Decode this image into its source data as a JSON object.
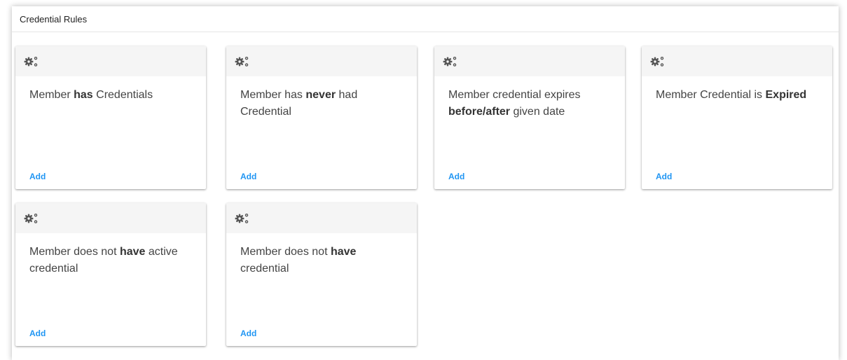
{
  "panel": {
    "title": "Credential Rules"
  },
  "cards": [
    {
      "icon": "gears-icon",
      "text_parts": [
        "Member ",
        "has",
        " Credentials"
      ],
      "action_label": "Add"
    },
    {
      "icon": "gears-icon",
      "text_parts": [
        "Member has ",
        "never",
        " had Credential"
      ],
      "action_label": "Add"
    },
    {
      "icon": "gears-icon",
      "text_parts": [
        "Member credential expires ",
        "before/after",
        " given date"
      ],
      "action_label": "Add"
    },
    {
      "icon": "gears-icon",
      "text_parts": [
        "Member Credential is ",
        "Expired",
        ""
      ],
      "action_label": "Add"
    },
    {
      "icon": "gears-icon",
      "text_parts": [
        "Member does not ",
        "have",
        " active credential"
      ],
      "action_label": "Add"
    },
    {
      "icon": "gears-icon",
      "text_parts": [
        "Member does not ",
        "have",
        " credential"
      ],
      "action_label": "Add"
    }
  ],
  "colors": {
    "link": "#2196f3",
    "card_header_bg": "#f5f5f5",
    "icon": "#555555"
  }
}
